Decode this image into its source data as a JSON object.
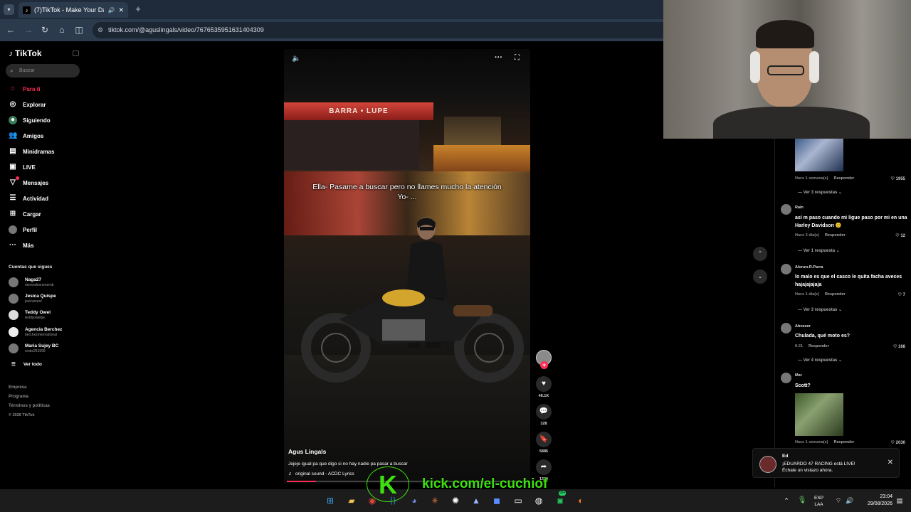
{
  "browser": {
    "tab_title": "(7)TikTok - Make Your Day",
    "url": "tiktok.com/@aguslingals/video/7676535951631404309"
  },
  "sidebar": {
    "logo": "TikTok",
    "search_placeholder": "Buscar",
    "nav": [
      {
        "label": "Para ti",
        "icon": "home-icon",
        "active": true
      },
      {
        "label": "Explorar",
        "icon": "compass-icon"
      },
      {
        "label": "Siguiendo",
        "icon": "following-icon"
      },
      {
        "label": "Amigos",
        "icon": "friends-icon"
      },
      {
        "label": "Minidramas",
        "icon": "minidramas-icon"
      },
      {
        "label": "LIVE",
        "icon": "live-icon"
      },
      {
        "label": "Mensajes",
        "icon": "messages-icon",
        "badge": "3"
      },
      {
        "label": "Actividad",
        "icon": "activity-icon"
      },
      {
        "label": "Cargar",
        "icon": "upload-icon"
      },
      {
        "label": "Perfil",
        "icon": "profile-icon"
      },
      {
        "label": "Más",
        "icon": "more-icon"
      }
    ],
    "following_title": "Cuentas que sigues",
    "following": [
      {
        "name": "Naga27",
        "handle": "mercedesromerob"
      },
      {
        "name": "Jesica Quispe",
        "handle": "jesicacarol"
      },
      {
        "name": "Teddy Owel",
        "handle": "teddyowelpe"
      },
      {
        "name": "Agencia Berchez",
        "handle": "berchezinternational"
      },
      {
        "name": "Maria Sujey BC",
        "handle": "smbc251999"
      }
    ],
    "see_all": "Ver todo",
    "footer": [
      "Empresa",
      "Programa",
      "Términos y políticas",
      "© 2026 TikTok"
    ]
  },
  "video": {
    "awning_sign": "BARRA • LUPE",
    "subtitle_line1": "Ella- Pasame a buscar pero no llames mucho la atención",
    "subtitle_line2": "Yo- ...",
    "author": "Agus Lingals",
    "caption": "Jejeje igual pa que digo si no hay nadie pa pasar a buscar",
    "sound": "original sound - ACDC Lyrics",
    "progress": 0.12
  },
  "actions": {
    "likes": "46.1K",
    "comments": "328",
    "saves": "5885",
    "shares": "1339"
  },
  "comments": [
    {
      "user": "",
      "text": "",
      "meta": "Hace 1 semana(s)",
      "reply": "Responder",
      "likes": "1955",
      "replies": "Ver 3 respuestas"
    },
    {
      "user": "Rain",
      "text": "así m paso cuando mi ligue paso por mi en una Harley Davidson 😊",
      "meta": "Hace 3 día(s)",
      "reply": "Responder",
      "likes": "12",
      "replies": "Ver 1 respuesta"
    },
    {
      "user": "Alonzo.R.Parra",
      "text": "lo malo es que el casco le quita facha aveces hajajajajaja",
      "meta": "Hace 1 día(s)",
      "reply": "Responder",
      "likes": "7",
      "replies": "Ver 3 respuestas"
    },
    {
      "user": "Abneeer",
      "text": "Chulada, qué moto es?",
      "meta": "8-21",
      "reply": "Responder",
      "likes": "168",
      "replies": "Ver 4 respuestas"
    },
    {
      "user": "Mar",
      "text": "Scott?",
      "meta": "Hace 1 semana(s)",
      "reply": "Responder",
      "likes": "2030",
      "replies": ""
    }
  ],
  "notification": {
    "title": "Ed",
    "body_line1": "¡EDUARDO 47 RACING está LIVE!",
    "body_line2": "Échale un vistazo ahora."
  },
  "overlay": {
    "kick_letter": "K",
    "kick_text": "kick.com/el-cuchiof"
  },
  "taskbar": {
    "lang": "ESP",
    "lang2": "LAA",
    "time": "23:04",
    "date": "29/08/2026",
    "badge": "99+"
  }
}
